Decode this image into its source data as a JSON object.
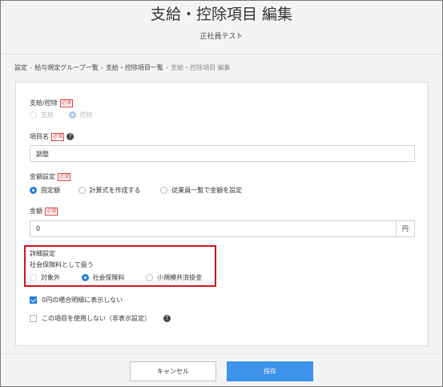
{
  "header": {
    "title": "支給・控除項目 編集",
    "subtitle": "正社員テスト"
  },
  "breadcrumb": {
    "items": [
      "設定",
      "給与規定グループ一覧",
      "支給・控除項目一覧",
      "支給・控除項目 編集"
    ],
    "separator": "›"
  },
  "form": {
    "required_tag": "必須",
    "type": {
      "label": "支給/控除",
      "options": [
        "支給",
        "控除"
      ],
      "selected": "控除"
    },
    "item_name": {
      "label": "項目名",
      "value": "調整"
    },
    "amount_setting": {
      "label": "金額設定",
      "options": [
        "固定額",
        "計算式を作成する",
        "従業員一覧で金額を設定"
      ],
      "selected": "固定額"
    },
    "amount": {
      "label": "金額",
      "value": "0",
      "unit": "円"
    },
    "detail": {
      "title": "詳細設定",
      "social_insurance_label": "社会保険料として扱う",
      "options": [
        "対象外",
        "社会保険料",
        "小規模共済掛金"
      ],
      "selected": "社会保険料"
    },
    "hide_if_zero": {
      "label": "0円の場合明細に表示しない",
      "checked": true
    },
    "unused": {
      "label": "この項目を使用しない（非表示設定）",
      "checked": false
    }
  },
  "footer": {
    "cancel_label": "キャンセル",
    "save_label": "保存"
  },
  "colors": {
    "accent": "#1f7fe0",
    "save_button": "#3d92ea",
    "required": "#e04040",
    "highlight_box": "#d0141b"
  }
}
